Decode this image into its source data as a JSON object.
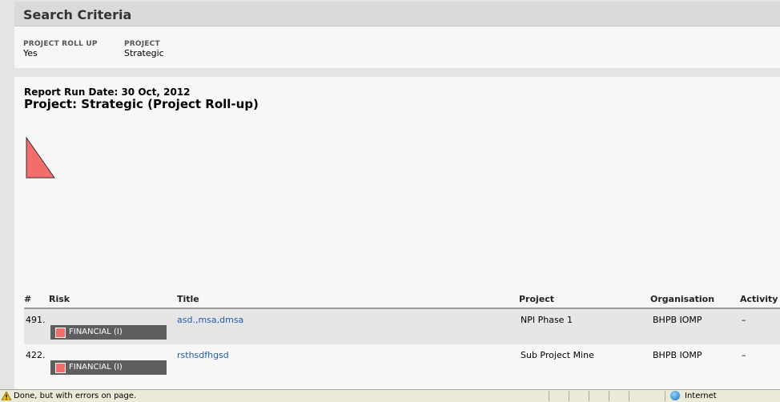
{
  "search": {
    "header": "Search Criteria",
    "criteria": [
      {
        "label": "PROJECT ROLL UP",
        "value": "Yes"
      },
      {
        "label": "PROJECT",
        "value": "Strategic"
      }
    ]
  },
  "report": {
    "run_date": "Report Run Date: 30 Oct, 2012",
    "title": "Project: Strategic (Project Roll-up)"
  },
  "table": {
    "headers": [
      "#",
      "Risk",
      "Title",
      "Project",
      "Organisation",
      "Activity"
    ],
    "rows": [
      {
        "num": "491.",
        "risk": "FINANCIAL (I)",
        "title": "asd.,msa,dmsa",
        "project": "NPI Phase 1",
        "org": "BHPB IOMP",
        "activity": "–"
      },
      {
        "num": "422.",
        "risk": "FINANCIAL (I)",
        "title": "rsthsdfhgsd",
        "project": "Sub Project Mine",
        "org": "BHPB IOMP",
        "activity": "–"
      }
    ]
  },
  "colors": {
    "risk_marker": "#f46d6d",
    "link": "#1f5ea8"
  },
  "statusbar": {
    "text": "Done, but with errors on page.",
    "zone": "Internet"
  }
}
